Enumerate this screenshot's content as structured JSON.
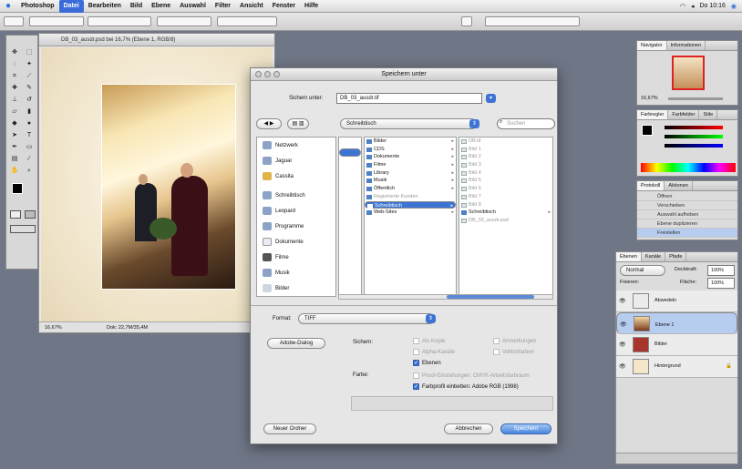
{
  "menubar": {
    "app": "Photoshop",
    "items": [
      "Datei",
      "Bearbeiten",
      "Bild",
      "Ebene",
      "Auswahl",
      "Filter",
      "Ansicht",
      "Fenster",
      "Hilfe"
    ],
    "active": "Datei",
    "clock": "Do 10:16"
  },
  "document": {
    "title": "DB_03_ausdr.psd bei 16,7% (Ebene 1, RGB/8)",
    "zoom": "16,67%",
    "doc_info": "Dok: 22,7M/35,4M"
  },
  "dialog": {
    "title": "Speichern unter",
    "save_as_label": "Sichern unter:",
    "filename": "DB_03_ausdr.tif",
    "location": "Schreibtisch",
    "search_placeholder": "Suchen",
    "sidebar": [
      "Netzwerk",
      "Jaguar",
      "Cassita",
      "Schreibtisch",
      "Leopard",
      "Programme",
      "Dokumente",
      "Filme",
      "Musik",
      "Bilder"
    ],
    "col1": [
      "Bilder",
      "CDS",
      "Dokumente",
      "Filme",
      "Library",
      "Musik",
      "Öffentlich",
      "Registrierte Kunden",
      "Schreibtisch",
      "Web-Sites"
    ],
    "col1_selected": "Schreibtisch",
    "col2": [
      "DB.tif",
      "Bild 1",
      "Bild 2",
      "Bild 3",
      "Bild 4",
      "Bild 5",
      "Bild 6",
      "Bild 7",
      "Bild 8",
      "Schreibtisch",
      "DB_03_ausdr.psd"
    ],
    "format_label": "Format:",
    "format_value": "TIFF",
    "adobe_dialog": "Adobe-Dialog",
    "save_label": "Sichern:",
    "opts": {
      "als_kopie": "Als Kopie",
      "alpha": "Alpha-Kanäle",
      "ebenen": "Ebenen",
      "anmerkungen": "Anmerkungen",
      "volltonfarben": "Volltonfarben"
    },
    "color_label": "Farbe:",
    "proof": "Proof-Einstellungen: CMYK-Arbeitsfarbraum",
    "icc": "Farbprofil einbetten: Adobe RGB (1998)",
    "new_folder": "Neuer Ordner",
    "cancel": "Abbrechen",
    "save": "Speichern"
  },
  "panels": {
    "navigator_tabs": [
      "Navigator",
      "Informationen"
    ],
    "nav_zoom": "16,67%",
    "color_tabs": [
      "Farbregler",
      "Farbfelder",
      "Stile"
    ],
    "history_tabs": [
      "Protokoll",
      "Aktionen"
    ],
    "history": [
      "Öffnen",
      "Verschieben",
      "Auswahl aufheben",
      "Ebene duplizieren",
      "Freistellen"
    ],
    "layers_tabs": [
      "Ebenen",
      "Kanäle",
      "Pfade"
    ],
    "blend": "Normal",
    "opacity_label": "Deckkraft:",
    "opacity": "100%",
    "fix_label": "Fixieren:",
    "fill_label": "Fläche:",
    "fill": "100%",
    "layers": [
      "Abwedeln",
      "Ebene 1",
      "Bilder",
      "Hintergrund"
    ]
  }
}
